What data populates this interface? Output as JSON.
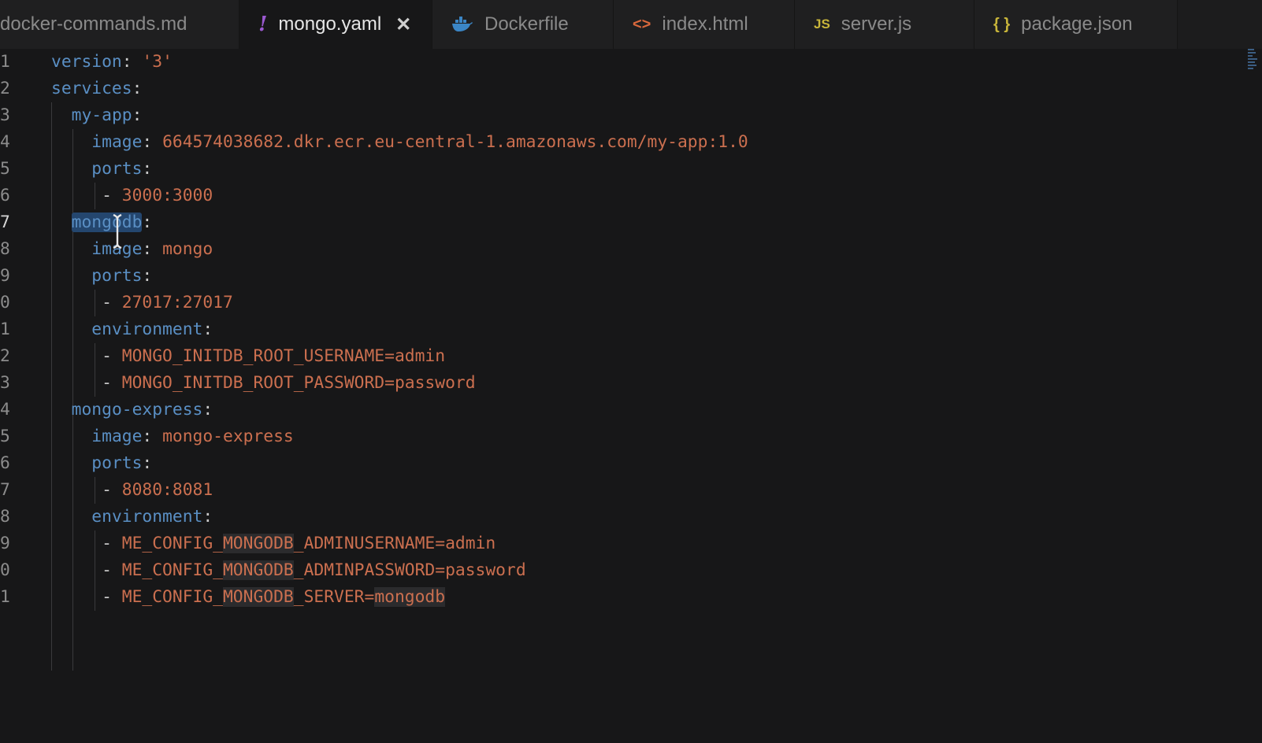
{
  "tabs": [
    {
      "label": "docker-commands.md",
      "icon": "none",
      "active": false
    },
    {
      "label": "mongo.yaml",
      "icon": "yaml-exclamation-icon",
      "active": true,
      "close": "✕"
    },
    {
      "label": "Dockerfile",
      "icon": "docker-whale-icon",
      "active": false
    },
    {
      "label": "index.html",
      "icon": "html-brackets-icon",
      "active": false
    },
    {
      "label": "server.js",
      "icon": "js-icon",
      "active": false
    },
    {
      "label": "package.json",
      "icon": "json-braces-icon",
      "active": false
    }
  ],
  "icons": {
    "yaml": "!",
    "html": "<>",
    "js": "JS",
    "json": "{ }"
  },
  "editor": {
    "lines": [
      {
        "num": "1",
        "indent": "",
        "key": "version",
        "sep": ": ",
        "value": "'3'"
      },
      {
        "num": "2",
        "indent": "",
        "key": "services",
        "sep": ":",
        "value": ""
      },
      {
        "num": "3",
        "indent": "  ",
        "key": "my-app",
        "sep": ":",
        "value": ""
      },
      {
        "num": "4",
        "indent": "    ",
        "key": "image",
        "sep": ": ",
        "value": "664574038682.dkr.ecr.eu-central-1.amazonaws.com/my-app:1.0"
      },
      {
        "num": "5",
        "indent": "    ",
        "key": "ports",
        "sep": ":",
        "value": ""
      },
      {
        "num": "6",
        "indent": "     ",
        "key": "",
        "sep": "- ",
        "value": "3000:3000"
      },
      {
        "num": "7",
        "indent": "  ",
        "key": "mongodb",
        "sep": ":",
        "value": ""
      },
      {
        "num": "8",
        "indent": "    ",
        "key": "image",
        "sep": ": ",
        "value": "mongo"
      },
      {
        "num": "9",
        "indent": "    ",
        "key": "ports",
        "sep": ":",
        "value": ""
      },
      {
        "num": "0",
        "indent": "     ",
        "key": "",
        "sep": "- ",
        "value": "27017:27017"
      },
      {
        "num": "1",
        "indent": "    ",
        "key": "environment",
        "sep": ":",
        "value": ""
      },
      {
        "num": "2",
        "indent": "     ",
        "key": "",
        "sep": "- ",
        "value": "MONGO_INITDB_ROOT_USERNAME=admin"
      },
      {
        "num": "3",
        "indent": "     ",
        "key": "",
        "sep": "- ",
        "value": "MONGO_INITDB_ROOT_PASSWORD=password"
      },
      {
        "num": "4",
        "indent": "  ",
        "key": "mongo-express",
        "sep": ":",
        "value": ""
      },
      {
        "num": "5",
        "indent": "    ",
        "key": "image",
        "sep": ": ",
        "value": "mongo-express"
      },
      {
        "num": "6",
        "indent": "    ",
        "key": "ports",
        "sep": ":",
        "value": ""
      },
      {
        "num": "7",
        "indent": "     ",
        "key": "",
        "sep": "- ",
        "value": "8080:8081"
      },
      {
        "num": "8",
        "indent": "    ",
        "key": "environment",
        "sep": ":",
        "value": ""
      },
      {
        "num": "9",
        "indent": "     ",
        "key": "",
        "sep": "- ",
        "value": "ME_CONFIG_MONGODB_ADMINUSERNAME=admin"
      },
      {
        "num": "0",
        "indent": "     ",
        "key": "",
        "sep": "- ",
        "value": "ME_CONFIG_MONGODB_ADMINPASSWORD=password"
      },
      {
        "num": "1",
        "indent": "     ",
        "key": "",
        "sep": "- ",
        "value": "ME_CONFIG_MONGODB_SERVER=mongodb"
      }
    ],
    "current_line_index": 6,
    "selected_word": "mongodb"
  },
  "colors": {
    "background": "#171718",
    "key": "#5a8fc4",
    "string": "#cb6f4f",
    "selection": "#24466e",
    "yaml_icon": "#9b59d0",
    "docker_icon": "#3b86c6",
    "html_icon": "#d9683c",
    "js_icon": "#c8b53a",
    "json_icon": "#c8b53a"
  }
}
